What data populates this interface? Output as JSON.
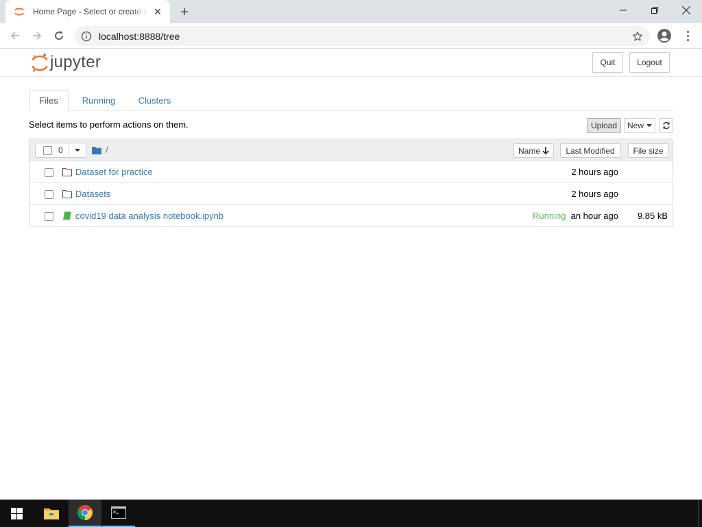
{
  "browser": {
    "tab_title": "Home Page - Select or create a notebook",
    "url": "localhost:8888/tree"
  },
  "header": {
    "logo_text": "jupyter",
    "quit_label": "Quit",
    "logout_label": "Logout"
  },
  "tabs": [
    {
      "label": "Files",
      "active": true
    },
    {
      "label": "Running",
      "active": false
    },
    {
      "label": "Clusters",
      "active": false
    }
  ],
  "actions": {
    "select_message": "Select items to perform actions on them.",
    "upload_label": "Upload",
    "new_label": "New"
  },
  "list": {
    "selected_count": "0",
    "breadcrumb": "/",
    "sort_name_label": "Name",
    "sort_modified_label": "Last Modified",
    "sort_size_label": "File size",
    "items": [
      {
        "type": "folder",
        "name": "Dataset for practice",
        "status": "",
        "modified": "2 hours ago",
        "size": ""
      },
      {
        "type": "folder",
        "name": "Datasets",
        "status": "",
        "modified": "2 hours ago",
        "size": ""
      },
      {
        "type": "notebook",
        "name": "covid19 data analysis notebook.ipynb",
        "status": "Running",
        "modified": "an hour ago",
        "size": "9.85 kB"
      }
    ]
  },
  "colors": {
    "link": "#337ab7",
    "running": "#5cb85c",
    "jupyter_orange": "#f37726"
  },
  "taskbar": {
    "apps": [
      "windows-start-icon",
      "file-explorer-icon",
      "chrome-icon",
      "command-prompt-icon"
    ]
  }
}
